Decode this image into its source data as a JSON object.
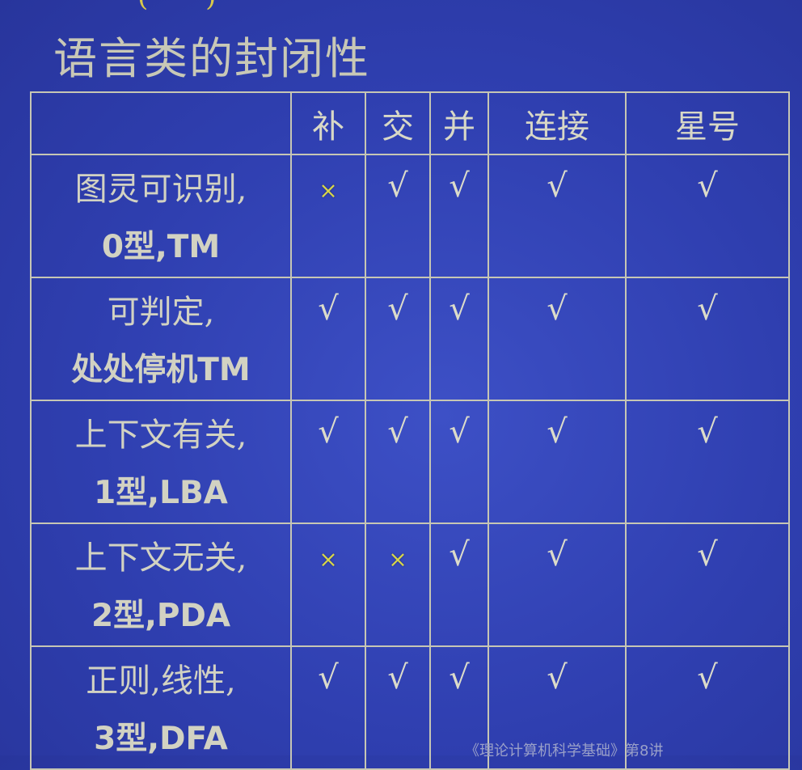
{
  "slide": {
    "top_fragment": "(   )",
    "title": "语言类的封闭性",
    "footer": "《理论计算机科学基础》第8讲"
  },
  "table": {
    "columns": [
      "补",
      "交",
      "并",
      "连接",
      "星号"
    ],
    "rows": [
      {
        "label_line1": "图灵可识别,",
        "label_line2": "0型,TM",
        "marks": [
          "×",
          "√",
          "√",
          "√",
          "√"
        ]
      },
      {
        "label_line1": "可判定,",
        "label_line2": "处处停机TM",
        "marks": [
          "√",
          "√",
          "√",
          "√",
          "√"
        ]
      },
      {
        "label_line1": "上下文有关,",
        "label_line2": "1型,LBA",
        "marks": [
          "√",
          "√",
          "√",
          "√",
          "√"
        ]
      },
      {
        "label_line1": "上下文无关,",
        "label_line2": "2型,PDA",
        "marks": [
          "×",
          "×",
          "√",
          "√",
          "√"
        ]
      },
      {
        "label_line1": "正则,线性,",
        "label_line2": "3型,DFA",
        "marks": [
          "√",
          "√",
          "√",
          "√",
          "√"
        ]
      }
    ]
  },
  "colors": {
    "background": "#3346b8",
    "text": "#d6d6c8",
    "cross_mark": "#d8d64a",
    "grid_line": "#c6c6b4"
  }
}
